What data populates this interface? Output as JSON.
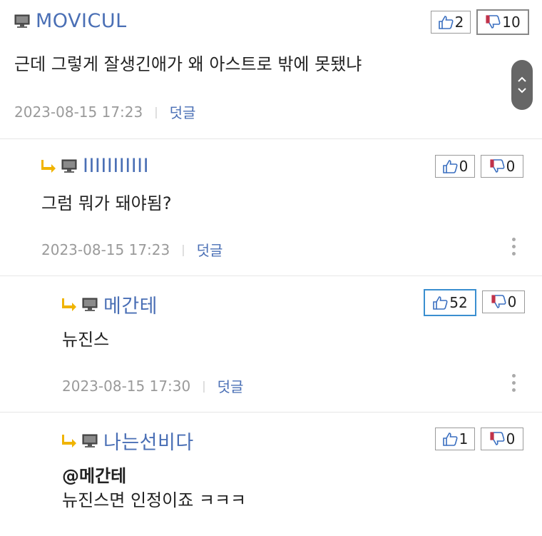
{
  "comments": [
    {
      "nick": "MOVICUL",
      "text": "근데 그렇게 잘생긴애가 왜 아스트로 밖에 못됐냐",
      "date": "2023-08-15 17:23",
      "reply_label": "덧글",
      "up": "2",
      "down": "10"
    },
    {
      "nick": "IIIIIIIIIII",
      "text": "그럼 뭐가 돼야됨?",
      "date": "2023-08-15 17:23",
      "reply_label": "덧글",
      "up": "0",
      "down": "0"
    },
    {
      "nick": "메간테",
      "text": "뉴진스",
      "date": "2023-08-15 17:30",
      "reply_label": "덧글",
      "up": "52",
      "down": "0"
    },
    {
      "nick": "나는선비다",
      "mention": "@메간테",
      "text": "뉴진스면 인정이죠 ㅋㅋㅋ",
      "up": "1",
      "down": "0"
    }
  ],
  "meta_separator": "|",
  "icons": {
    "pc": "computer-icon",
    "reply": "reply-arrow-icon",
    "up": "thumbs-up-icon",
    "down": "thumbs-down-icon",
    "more": "more-vertical-icon",
    "scroll": "scroll-up-down-icon"
  },
  "colors": {
    "nick": "#4a6fb5",
    "date": "#9a9a9a",
    "reply_arrow": "#f0b400",
    "active_up_border": "#3a8fd0"
  }
}
